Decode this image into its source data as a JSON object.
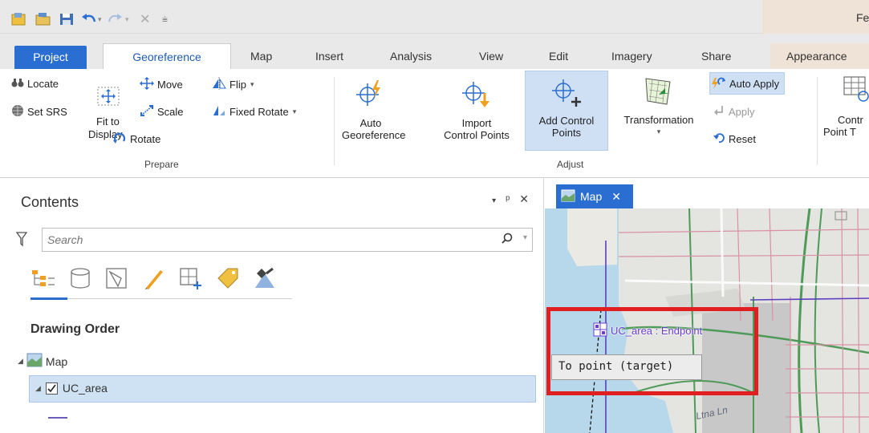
{
  "app": {
    "title_partial": "Fe",
    "accent": "#2b6ed1"
  },
  "tabs": [
    {
      "label": "Project"
    },
    {
      "label": "Georeference"
    },
    {
      "label": "Map"
    },
    {
      "label": "Insert"
    },
    {
      "label": "Analysis"
    },
    {
      "label": "View"
    },
    {
      "label": "Edit"
    },
    {
      "label": "Imagery"
    },
    {
      "label": "Share"
    },
    {
      "label": "Appearance"
    }
  ],
  "ribbon": {
    "prepare": {
      "locate": "Locate",
      "set_srs": "Set SRS",
      "fit_to_display": "Fit to Display",
      "fit_line1": "Fit to",
      "fit_line2": "Display",
      "move": "Move",
      "scale": "Scale",
      "rotate": "Rotate",
      "flip": "Flip",
      "fixed_rotate": "Fixed Rotate",
      "group": "Prepare"
    },
    "adjust": {
      "auto_line1": "Auto",
      "auto_line2": "Georeference",
      "import_line1": "Import",
      "import_line2": "Control Points",
      "add_line1": "Add Control",
      "add_line2": "Points",
      "transformation": "Transformation",
      "auto_apply": "Auto Apply",
      "apply": "Apply",
      "reset": "Reset",
      "group": "Adjust"
    },
    "review": {
      "cpt_line1": "Contr",
      "cpt_line2": "Point T"
    }
  },
  "contents": {
    "title": "Contents",
    "search_placeholder": "Search",
    "drawing_order": "Drawing Order",
    "map_layer": "Map",
    "uc_layer": "UC_area"
  },
  "map": {
    "tab_label": "Map",
    "endpoint_label": "UC_area : Endpoint",
    "callout": "To point (target)",
    "street": "Ltna Ln"
  }
}
